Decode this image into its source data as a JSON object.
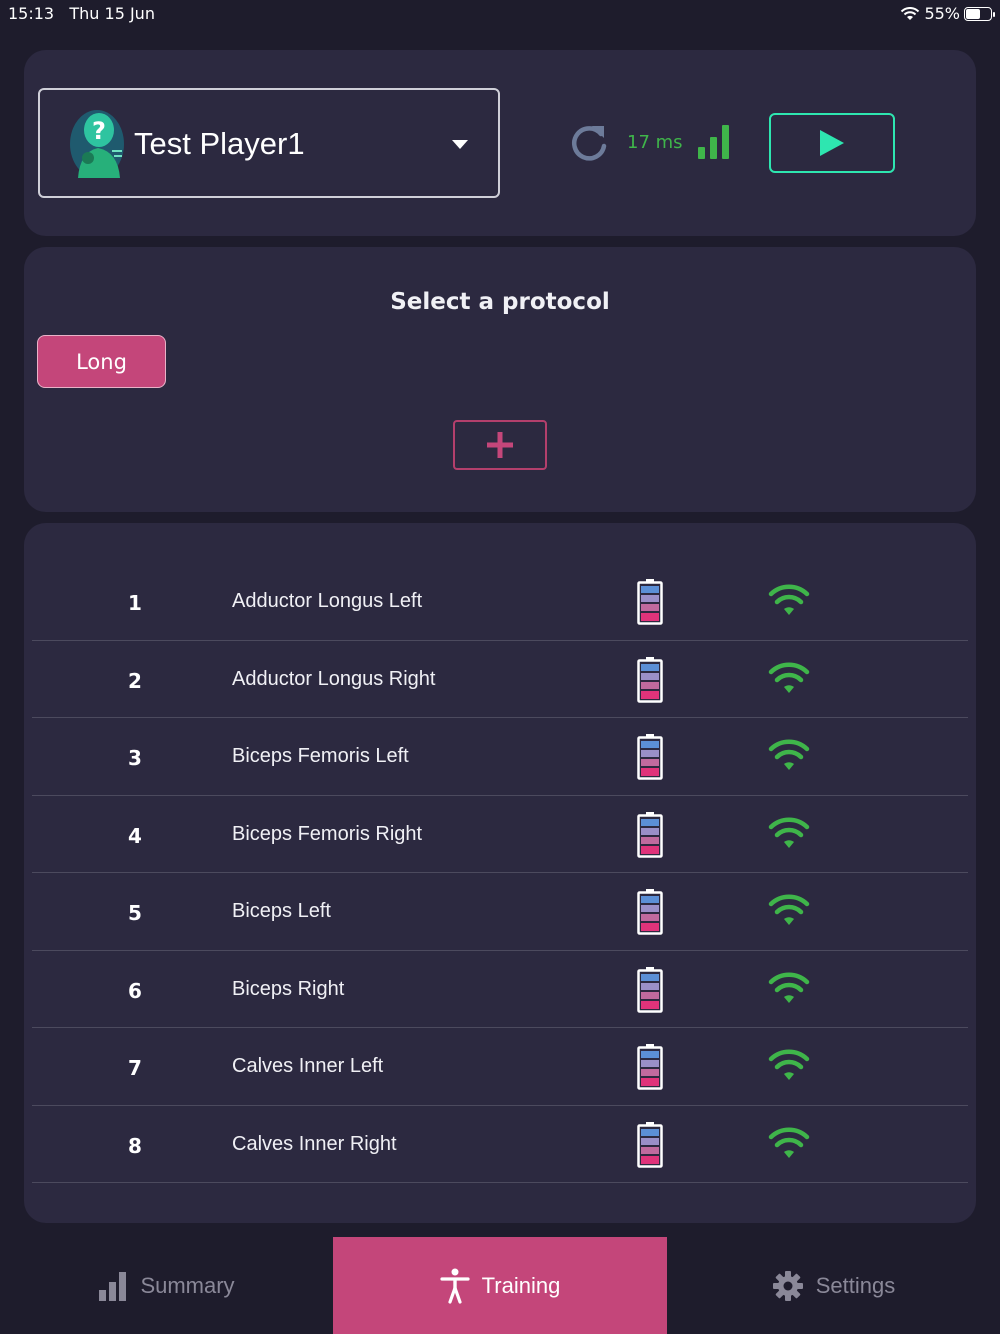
{
  "status_bar": {
    "time": "15:13",
    "date": "Thu 15 Jun",
    "battery": "55%"
  },
  "header": {
    "player_name": "Test Player1",
    "latency": "17 ms"
  },
  "protocol": {
    "title": "Select a protocol",
    "chips": [
      "Long"
    ]
  },
  "sensors": [
    {
      "num": "1",
      "name": "Adductor Longus Left"
    },
    {
      "num": "2",
      "name": "Adductor Longus Right"
    },
    {
      "num": "3",
      "name": "Biceps Femoris Left"
    },
    {
      "num": "4",
      "name": "Biceps Femoris Right"
    },
    {
      "num": "5",
      "name": "Biceps Left"
    },
    {
      "num": "6",
      "name": "Biceps Right"
    },
    {
      "num": "7",
      "name": "Calves Inner Left"
    },
    {
      "num": "8",
      "name": "Calves Inner Right"
    }
  ],
  "nav": {
    "summary": "Summary",
    "training": "Training",
    "settings": "Settings"
  },
  "colors": {
    "accent": "#c4467a",
    "play": "#2ee6b0",
    "good": "#3fb54a",
    "card": "#2c2940",
    "background": "#1e1c2c"
  }
}
